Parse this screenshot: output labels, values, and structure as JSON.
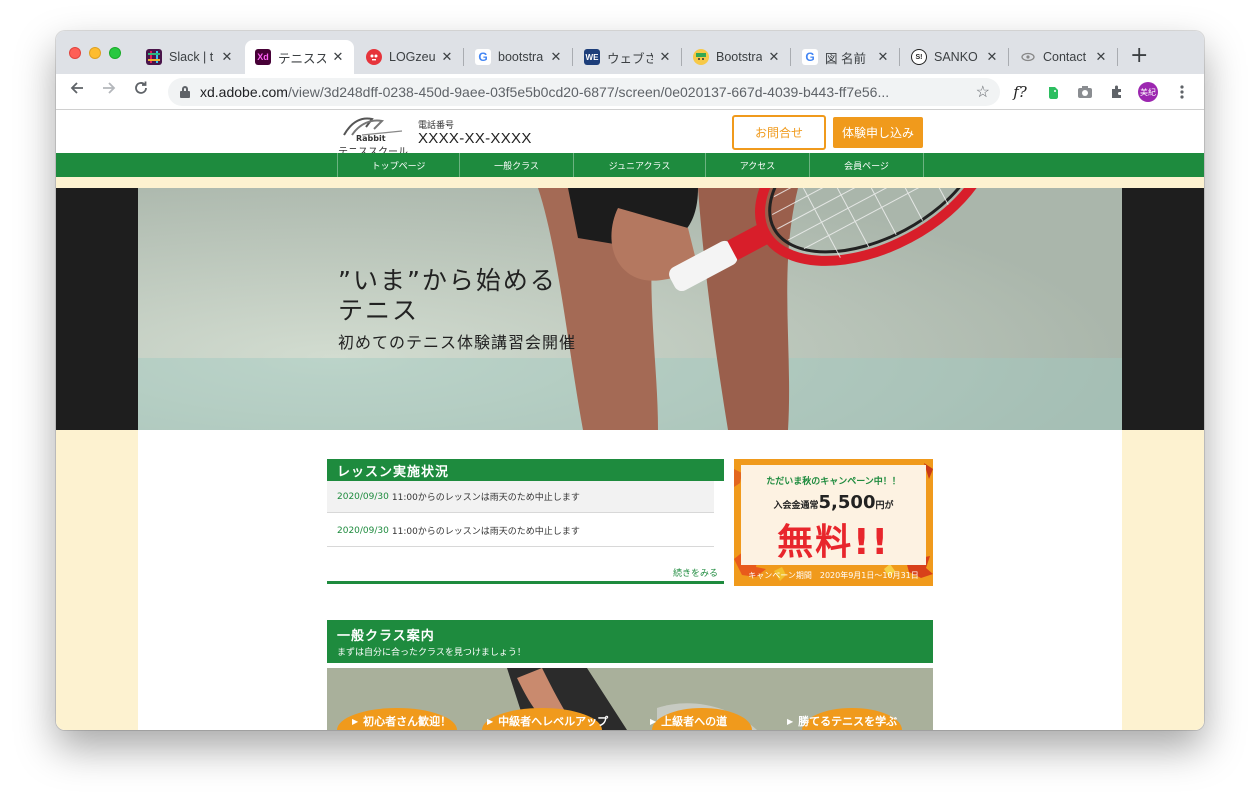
{
  "browser": {
    "tabs": [
      {
        "label": "Slack | t",
        "icon": "slack-icon"
      },
      {
        "label": "テニスス",
        "icon": "xd-icon",
        "icon_text": "Xd",
        "active": true
      },
      {
        "label": "LOGzeu",
        "icon": "logzeu-icon"
      },
      {
        "label": "bootstra",
        "icon": "google-icon",
        "icon_text": "G"
      },
      {
        "label": "ウェブさ",
        "icon": "web-icon",
        "icon_text": "WE"
      },
      {
        "label": "Bootstra",
        "icon": "bootstrap-icon"
      },
      {
        "label": "図 名前",
        "icon": "google-icon",
        "icon_text": "G"
      },
      {
        "label": "SANKO",
        "icon": "sanko-icon",
        "icon_text": "S!"
      },
      {
        "label": "Contact",
        "icon": "contact-icon"
      }
    ],
    "tab_close": "✕",
    "new_tab": "+",
    "url_host": "xd.adobe.com",
    "url_path": "/view/3d248dff-0238-450d-9aee-03f5e5b0cd20-6877/screen/0e020137-667d-4039-b443-ff7e56...",
    "ext_fx": "f?",
    "profile_initials": "美紀"
  },
  "site": {
    "logo_top": "Rabbit",
    "logo_bottom": "テニススクール",
    "phone_label": "電話番号",
    "phone_number": "XXXX-XX-XXXX",
    "inquiry_button": "お問合せ",
    "trial_button": "体験申し込み",
    "nav": [
      "トップページ",
      "一般クラス",
      "ジュニアクラス",
      "アクセス",
      "会員ページ"
    ]
  },
  "hero": {
    "headline_line1": "”いま”から始める",
    "headline_line2": "テニス",
    "subline": "初めてのテニス体験講習会開催",
    "slides": 3,
    "active_slide": 2
  },
  "lessons": {
    "title": "レッスン実施状況",
    "items": [
      {
        "date": "2020/09/30",
        "text": "11:00からのレッスンは雨天のため中止します"
      },
      {
        "date": "2020/09/30",
        "text": "11:00からのレッスンは雨天のため中止します"
      }
    ],
    "more": "続きをみる"
  },
  "campaign": {
    "now": "ただいま秋のキャンペーン中！！",
    "fee_prefix": "入会金通常",
    "fee_amount": "5,500",
    "fee_suffix": "円が",
    "free": "無料!!",
    "period": "キャンペーン期間　2020年9月1日〜10月31日"
  },
  "classes": {
    "title": "一般クラス案内",
    "subtitle": "まずは自分に合ったクラスを見つけましょう！",
    "tags": [
      "初心者さん歓迎！",
      "中級者へレベルアップ",
      "上級者への道",
      "勝てるテニスを学ぶ"
    ]
  },
  "colors": {
    "brand_green": "#1e8b3e",
    "accent_orange": "#f09a1c",
    "free_red": "#e8262c",
    "band_cream": "#fdf2d0"
  }
}
